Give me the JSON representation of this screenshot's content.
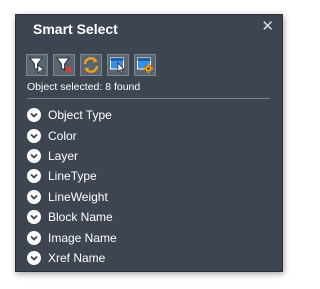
{
  "window": {
    "title": "Smart Select",
    "close_glyph": "✕"
  },
  "toolbar": {
    "buttons": [
      {
        "icon": "filter-select-icon"
      },
      {
        "icon": "filter-clear-icon"
      },
      {
        "icon": "refresh-icon"
      },
      {
        "icon": "select-window-icon"
      },
      {
        "icon": "select-settings-icon"
      }
    ]
  },
  "status": {
    "text": "Object selected: 8 found"
  },
  "filters": {
    "items": [
      {
        "label": "Object Type"
      },
      {
        "label": "Color"
      },
      {
        "label": "Layer"
      },
      {
        "label": "LineType"
      },
      {
        "label": "LineWeight"
      },
      {
        "label": "Block Name"
      },
      {
        "label": "Image Name"
      },
      {
        "label": "Xref Name"
      }
    ]
  },
  "colors": {
    "panel_bg": "#3d4650",
    "accent_blue": "#3a8ee6",
    "accent_orange": "#f3a221",
    "accent_red": "#e23b2e"
  }
}
